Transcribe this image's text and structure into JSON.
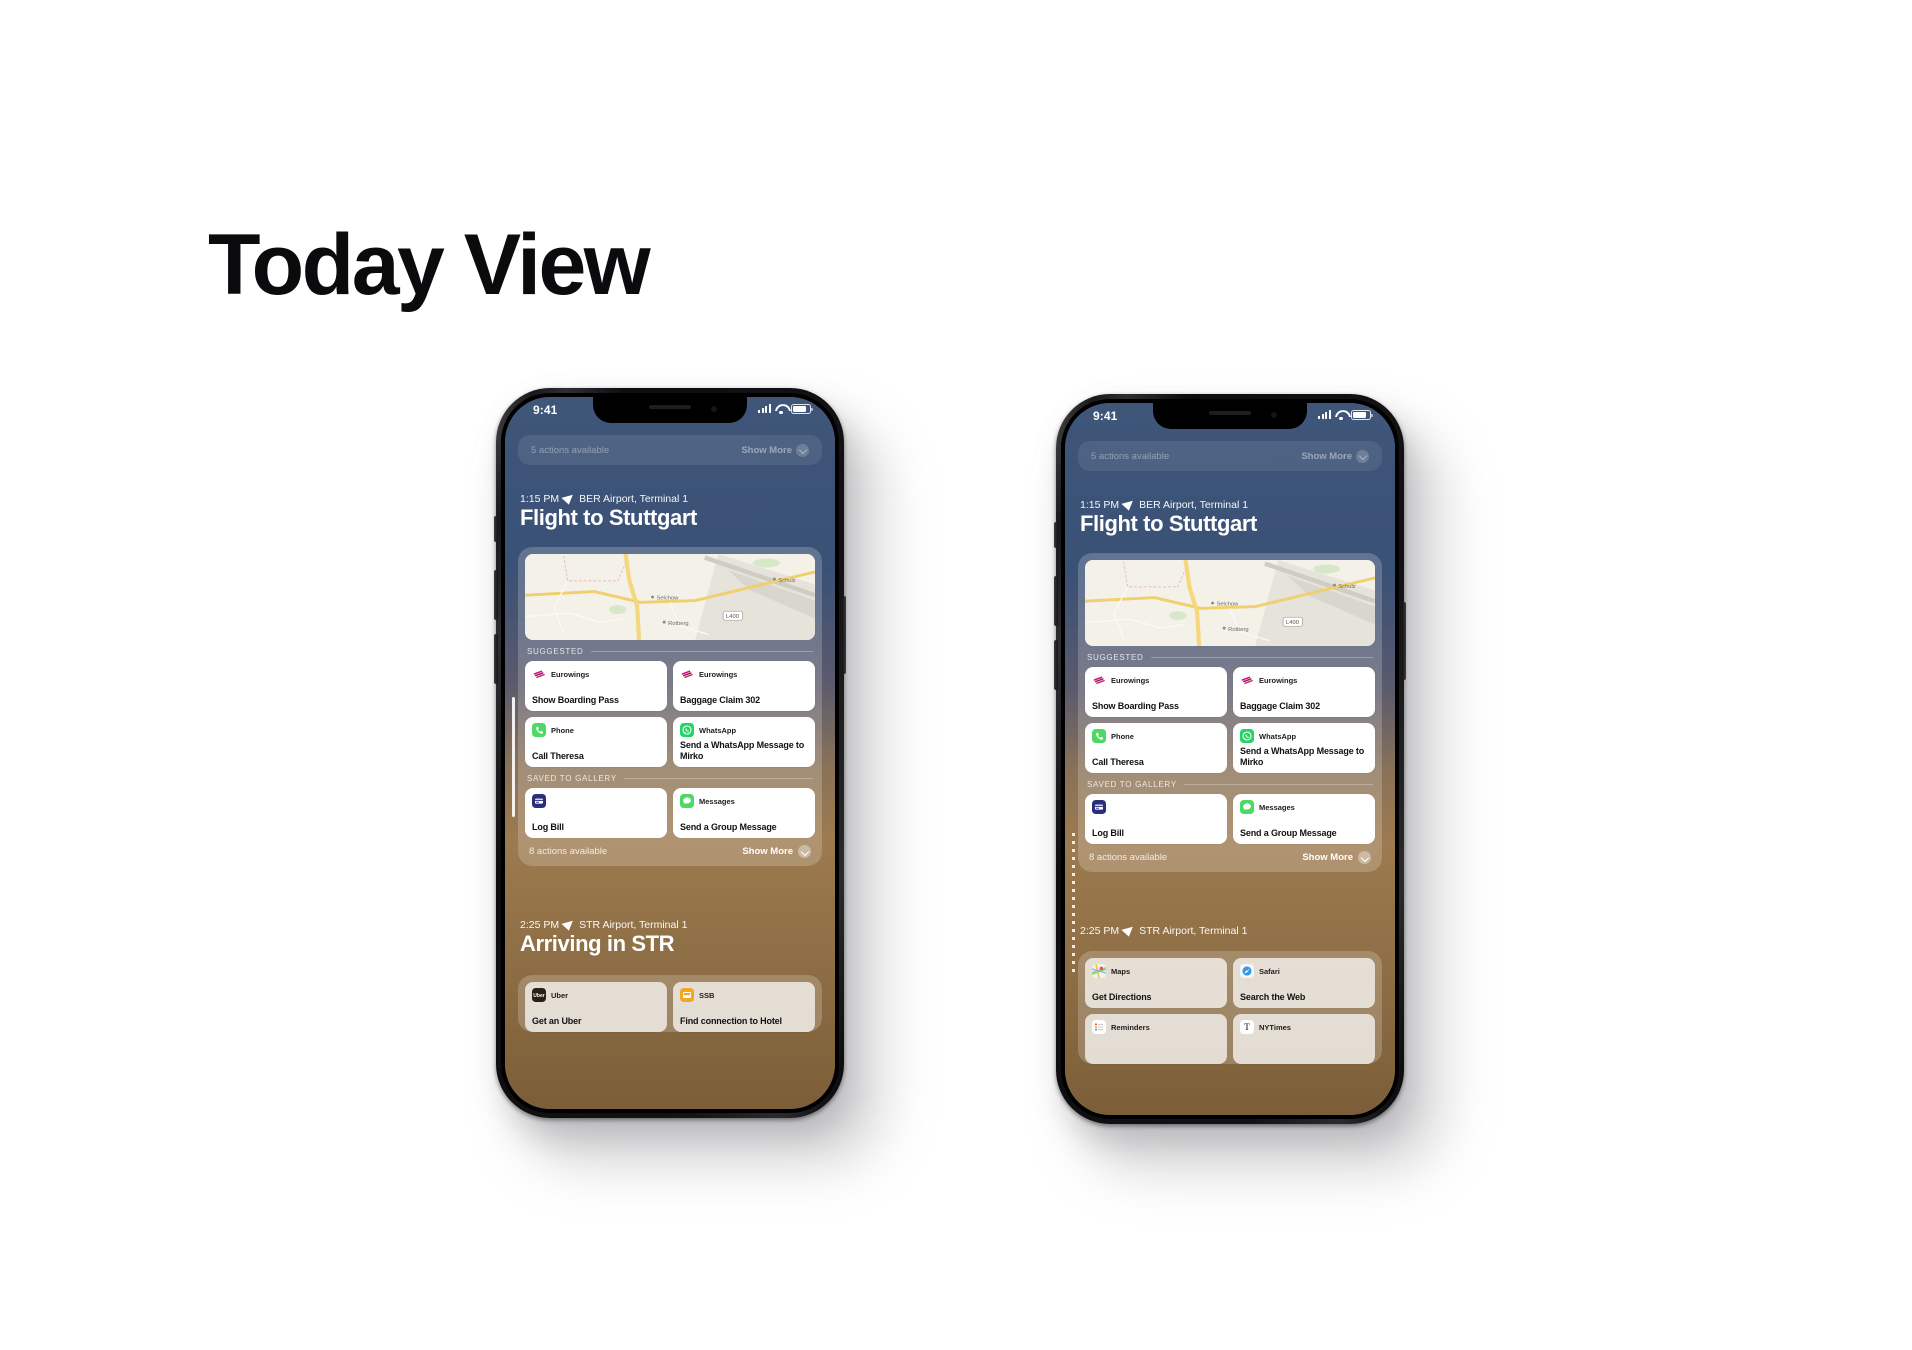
{
  "title": "Today View",
  "status_bar": {
    "time": "9:41",
    "wifi_icon": "wifi-icon",
    "cellular_icon": "signal-bars-icon",
    "battery_icon": "battery-icon"
  },
  "peek_card": {
    "left_label": "5 actions available",
    "right_label": "Show More",
    "chevron_icon": "chevron-down-circle-icon"
  },
  "events": [
    {
      "time": "1:15 PM",
      "location_icon": "location-arrow-icon",
      "location": "BER Airport, Terminal 1",
      "title": "Flight to Stuttgart",
      "map": {
        "labels": [
          "Selchow",
          "Rotberg",
          "Schulz"
        ],
        "road_shield": "L400"
      },
      "sections": [
        {
          "header": "SUGGESTED",
          "tiles": [
            {
              "app": "Eurowings",
              "icon": "eurowings-icon",
              "title": "Show Boarding Pass"
            },
            {
              "app": "Eurowings",
              "icon": "eurowings-icon",
              "title": "Baggage Claim 302"
            },
            {
              "app": "Phone",
              "icon": "phone-icon",
              "title": "Call Theresa"
            },
            {
              "app": "WhatsApp",
              "icon": "whatsapp-icon",
              "title": "Send a WhatsApp Message to Mirko"
            }
          ]
        },
        {
          "header": "SAVED TO GALLERY",
          "tiles": [
            {
              "app": "",
              "icon": "log-bill-icon",
              "title": "Log Bill"
            },
            {
              "app": "Messages",
              "icon": "messages-icon",
              "title": "Send a Group Message"
            }
          ]
        }
      ],
      "footer": {
        "left_label": "8 actions available",
        "right_label": "Show More",
        "chevron_icon": "chevron-down-circle-icon"
      }
    },
    {
      "time": "2:25 PM",
      "location_icon": "location-arrow-icon",
      "location": "STR Airport, Terminal 1",
      "title": "Arriving in STR",
      "tiles_left_phone": [
        {
          "app": "Uber",
          "icon": "uber-icon",
          "title": "Get an Uber"
        },
        {
          "app": "SSB",
          "icon": "ssb-icon",
          "title": "Find connection to Hotel"
        }
      ],
      "tiles_right_phone": [
        {
          "app": "Maps",
          "icon": "maps-icon",
          "title": "Get Directions"
        },
        {
          "app": "Safari",
          "icon": "safari-icon",
          "title": "Search the Web"
        },
        {
          "app": "Reminders",
          "icon": "reminders-icon",
          "title": ""
        },
        {
          "app": "NYTimes",
          "icon": "nytimes-icon",
          "title": ""
        }
      ]
    }
  ],
  "colors": {
    "sky_top": "#3f5679",
    "sky_bottom": "#7b5e38",
    "title_text": "#0b0b0d",
    "card_white": "#ffffff"
  }
}
